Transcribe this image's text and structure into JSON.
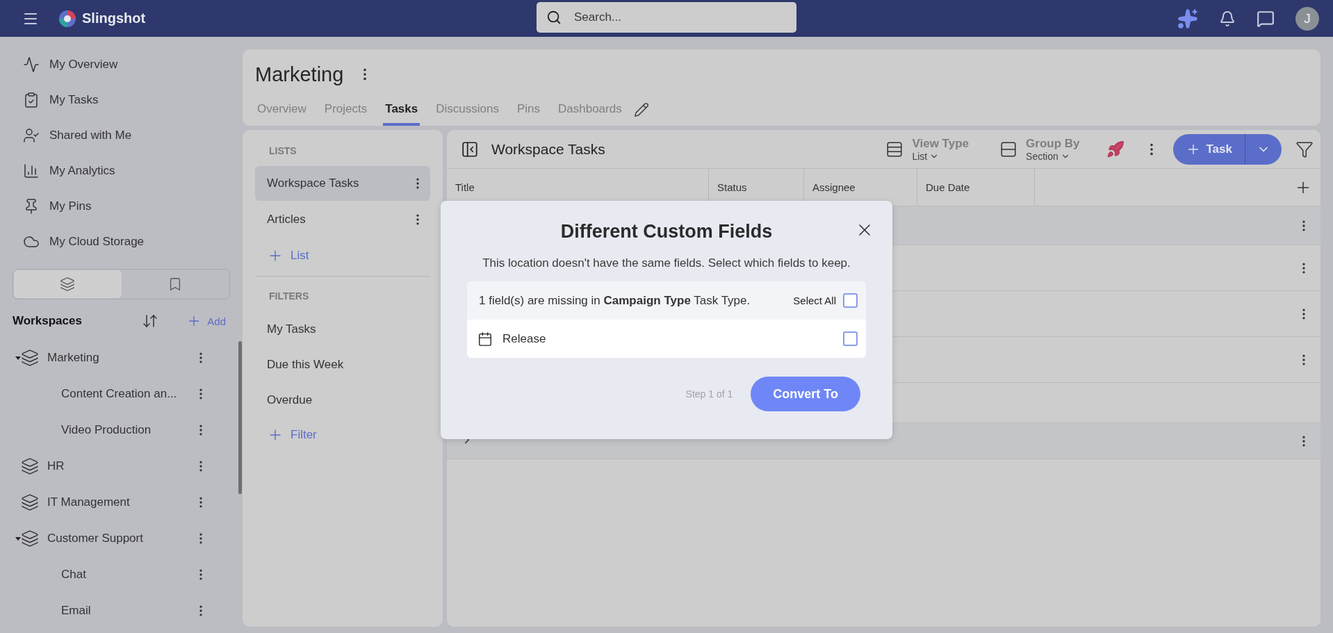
{
  "top_bar": {
    "app_name": "Slingshot",
    "search": {
      "placeholder": "Search..."
    },
    "avatar": "J"
  },
  "nav": [
    {
      "label": "My Overview",
      "kind": "activity"
    },
    {
      "label": "My Tasks",
      "kind": "tasks"
    },
    {
      "label": "Shared with Me",
      "kind": "shared"
    },
    {
      "label": "My Analytics",
      "kind": "analytics"
    },
    {
      "label": "My Pins",
      "kind": "pins"
    },
    {
      "label": "My Cloud Storage",
      "kind": "cloud"
    }
  ],
  "sidebar_tabs": [
    {
      "kind": "layers",
      "selected": true
    },
    {
      "kind": "bookmark",
      "selected": false
    }
  ],
  "workspaces": {
    "title": "Workspaces",
    "add": "Add",
    "items": [
      {
        "label": "Marketing",
        "expanded": true,
        "children": [
          {
            "label": "Content Creation an..."
          },
          {
            "label": "Video Production"
          }
        ]
      },
      {
        "label": "HR",
        "expanded": false
      },
      {
        "label": "IT Management",
        "expanded": false
      },
      {
        "label": "Customer Support",
        "expanded": true,
        "children": [
          {
            "label": "Chat"
          },
          {
            "label": "Email"
          }
        ]
      }
    ]
  },
  "project": {
    "title": "Marketing",
    "tabs": [
      {
        "label": "Overview",
        "selected": false
      },
      {
        "label": "Projects",
        "selected": false
      },
      {
        "label": "Tasks",
        "selected": true
      },
      {
        "label": "Discussions",
        "selected": false
      },
      {
        "label": "Pins",
        "selected": false
      },
      {
        "label": "Dashboards",
        "selected": false
      }
    ]
  },
  "lists_panel": {
    "lists_heading": "LISTS",
    "lists": [
      {
        "label": "Workspace Tasks",
        "selected": true
      },
      {
        "label": "Articles",
        "selected": false
      }
    ],
    "add_list": "List",
    "filters_heading": "FILTERS",
    "filters": [
      "My Tasks",
      "Due this Week",
      "Overdue"
    ],
    "add_filter": "Filter"
  },
  "table": {
    "title": "Workspace Tasks",
    "view_type": {
      "label": "View Type",
      "value": "List"
    },
    "group_by": {
      "label": "Group By",
      "value": "Section"
    },
    "new_button": "Task",
    "columns": [
      "Title",
      "Status",
      "Assignee",
      "Due Date"
    ],
    "rows": [
      {
        "kind": "group"
      },
      {
        "kind": "task"
      },
      {
        "kind": "task"
      },
      {
        "kind": "task"
      },
      {
        "kind": "blank"
      },
      {
        "kind": "collapsed"
      }
    ]
  },
  "dialog": {
    "title": "Different Custom Fields",
    "message": "This location doesn't have the same fields. Select which fields to keep.",
    "section_heading": "1 field(s) are missing in **Campaign Type** Task Type.",
    "select_all": {
      "label": "Select All",
      "checked": false
    },
    "fields": [
      {
        "label": "Release",
        "checked": false
      }
    ],
    "step": "Step 1 of 1",
    "confirm": "Convert To"
  }
}
